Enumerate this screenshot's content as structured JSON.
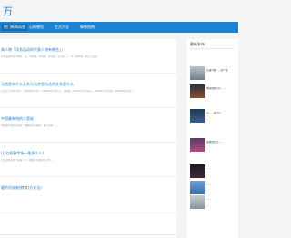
{
  "site": {
    "logo_text": "万"
  },
  "nav": {
    "items": [
      {
        "label": "热门新闻动态"
      },
      {
        "label": "心情感悟"
      },
      {
        "label": "生活大全"
      },
      {
        "label": "情感指南"
      }
    ]
  },
  "articles": [
    {
      "title": "具人物「洋务运动的代表人物有哪些」」",
      "excerpt": "洋务运动代表人物有：奕，曾国藩，李鸿章，左宗棠，张之洞……（1）在中央：恭亲王奕訢…"
    },
    {
      "title": "马克思有什么关系与马克思与达的关系是什么",
      "excerpt": "马克思（Karl Marx，1818年5月5日－1883年3月14日），恩格斯（Friedrich Engels，1820年11月28日－1895年8月5日）…"
    },
    {
      "title": "中国最有钱的人是谁",
      "excerpt": "中国最有钱的人是谁？根据胡润百富榜，截至目前……"
    },
    {
      "title": "(日红招募专场一般多少人)",
      "excerpt": "日红招募专场一般多少人？根据不同场次与平台……"
    },
    {
      "title": "健的学说被(教育)方式法)",
      "excerpt": "…"
    }
  ],
  "sidebar": {
    "title": "最新发布",
    "items": [
      {
        "text": "高速公路……多少钱"
      },
      {
        "text": "地铁站的灯光……"
      },
      {
        "text": "马……是什么"
      },
      {
        "text": "夜晚的灯光……"
      },
      {
        "text": "……"
      },
      {
        "text": "……"
      },
      {
        "text": "……"
      }
    ]
  }
}
